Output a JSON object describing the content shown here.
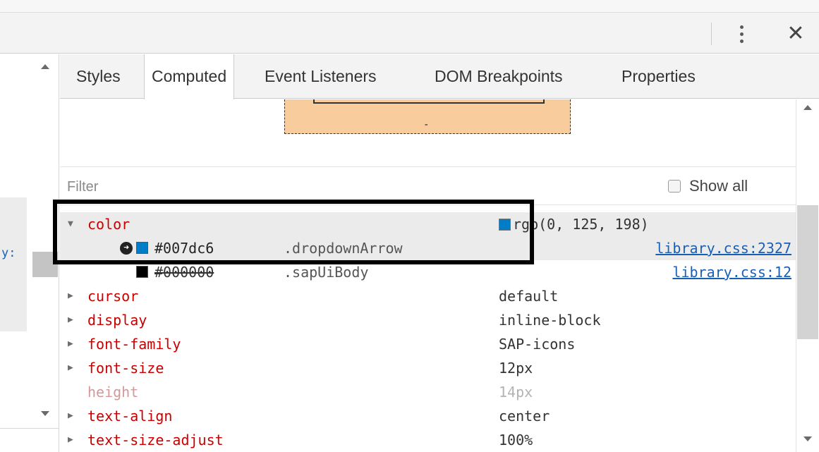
{
  "window": {
    "menu_icon": "more-vertical-icon",
    "close_label": "✕"
  },
  "left_pane": {
    "fragment_text": "y:"
  },
  "tabs": [
    {
      "label": "Styles",
      "active": false
    },
    {
      "label": "Computed",
      "active": true
    },
    {
      "label": "Event Listeners",
      "active": false
    },
    {
      "label": "DOM Breakpoints",
      "active": false
    },
    {
      "label": "Properties",
      "active": false
    }
  ],
  "box_model": {
    "content_text": "-"
  },
  "filter": {
    "placeholder": "Filter",
    "value": "",
    "show_all_label": "Show all",
    "show_all_checked": false
  },
  "properties": {
    "color": {
      "name": "color",
      "value": "rgb(0, 125, 198)",
      "swatch": "#007dc6",
      "expanded": true,
      "traces": [
        {
          "color": "#007dc6",
          "selector": ".dropdownArrow",
          "source": "library.css:2327",
          "overridden": false
        },
        {
          "color": "#000000",
          "selector": ".sapUiBody",
          "source": "library.css:12",
          "overridden": true
        }
      ]
    },
    "cursor": {
      "name": "cursor",
      "value": "default"
    },
    "display": {
      "name": "display",
      "value": "inline-block"
    },
    "font_family": {
      "name": "font-family",
      "value": "SAP-icons"
    },
    "font_size": {
      "name": "font-size",
      "value": "12px"
    },
    "height": {
      "name": "height",
      "value": "14px",
      "inherited": true
    },
    "text_align": {
      "name": "text-align",
      "value": "center"
    },
    "text_size_adjust": {
      "name": "text-size-adjust",
      "value": "100%"
    }
  },
  "colors": {
    "property_name": "#c80000",
    "link": "#1a5fb4",
    "highlight_border": "#000000"
  }
}
